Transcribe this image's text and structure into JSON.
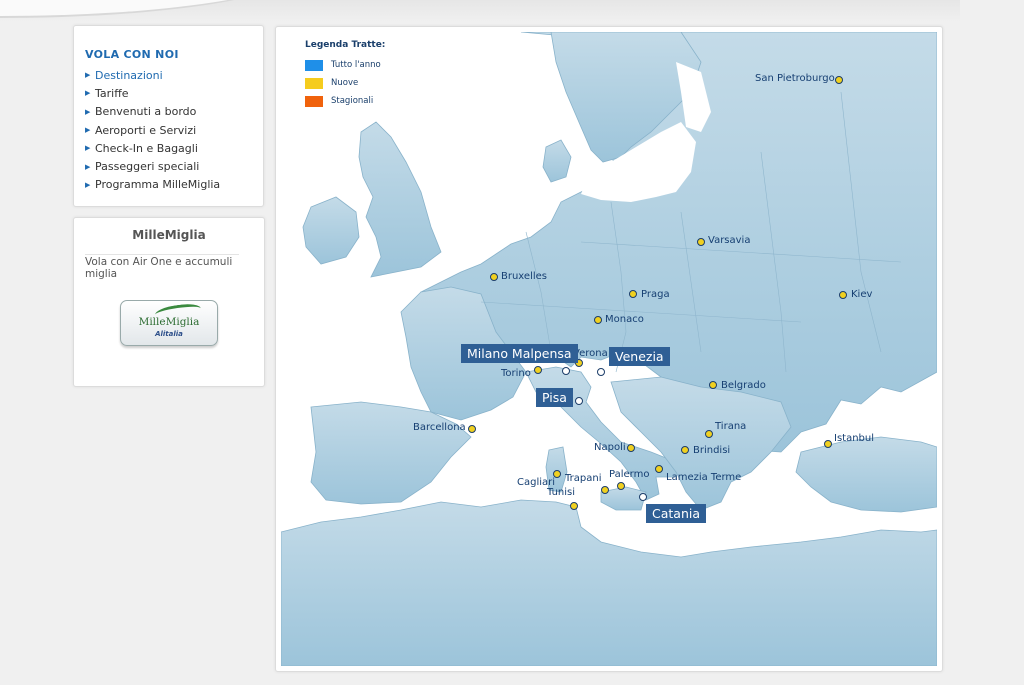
{
  "nav": {
    "title": "VOLA CON NOI",
    "items": [
      {
        "label": "Destinazioni",
        "active": true
      },
      {
        "label": "Tariffe"
      },
      {
        "label": "Benvenuti a bordo"
      },
      {
        "label": "Aeroporti e Servizi"
      },
      {
        "label": "Check-In e Bagagli"
      },
      {
        "label": "Passeggeri speciali"
      },
      {
        "label": "Programma MilleMiglia"
      }
    ]
  },
  "millemiglia": {
    "title": "MilleMiglia",
    "text": "Vola con Air One e accumuli miglia",
    "logo_text": "MilleMiglia",
    "logo_sub": "Alitalia"
  },
  "legend": {
    "title": "Legenda Tratte:",
    "items": [
      {
        "label": "Tutto l'anno",
        "color": "#1f8fe8"
      },
      {
        "label": "Nuove",
        "color": "#f5cc1e"
      },
      {
        "label": "Stagionali",
        "color": "#f0620c"
      }
    ]
  },
  "cities": {
    "san_pietroburgo": "San Pietroburgo",
    "varsavia": "Varsavia",
    "bruxelles": "Bruxelles",
    "praga": "Praga",
    "kiev": "Kiev",
    "monaco": "Monaco",
    "verona": "Verona",
    "torino": "Torino",
    "belgrado": "Belgrado",
    "barcellona": "Barcellona",
    "tirana": "Tirana",
    "napoli": "Napoli",
    "brindisi": "Brindisi",
    "istanbul": "Istanbul",
    "palermo": "Palermo",
    "lamezia": "Lamezia Terme",
    "cagliari": "Cagliari",
    "trapani": "Trapani",
    "tunisi": "Tunisi"
  },
  "hubs": {
    "milano": "Milano Malpensa",
    "venezia": "Venezia",
    "pisa": "Pisa",
    "catania": "Catania"
  },
  "colors": {
    "sea": "#ffffff",
    "land": "#a9cbde",
    "label": "#163f72",
    "hub_bg": "#2f5f95"
  }
}
